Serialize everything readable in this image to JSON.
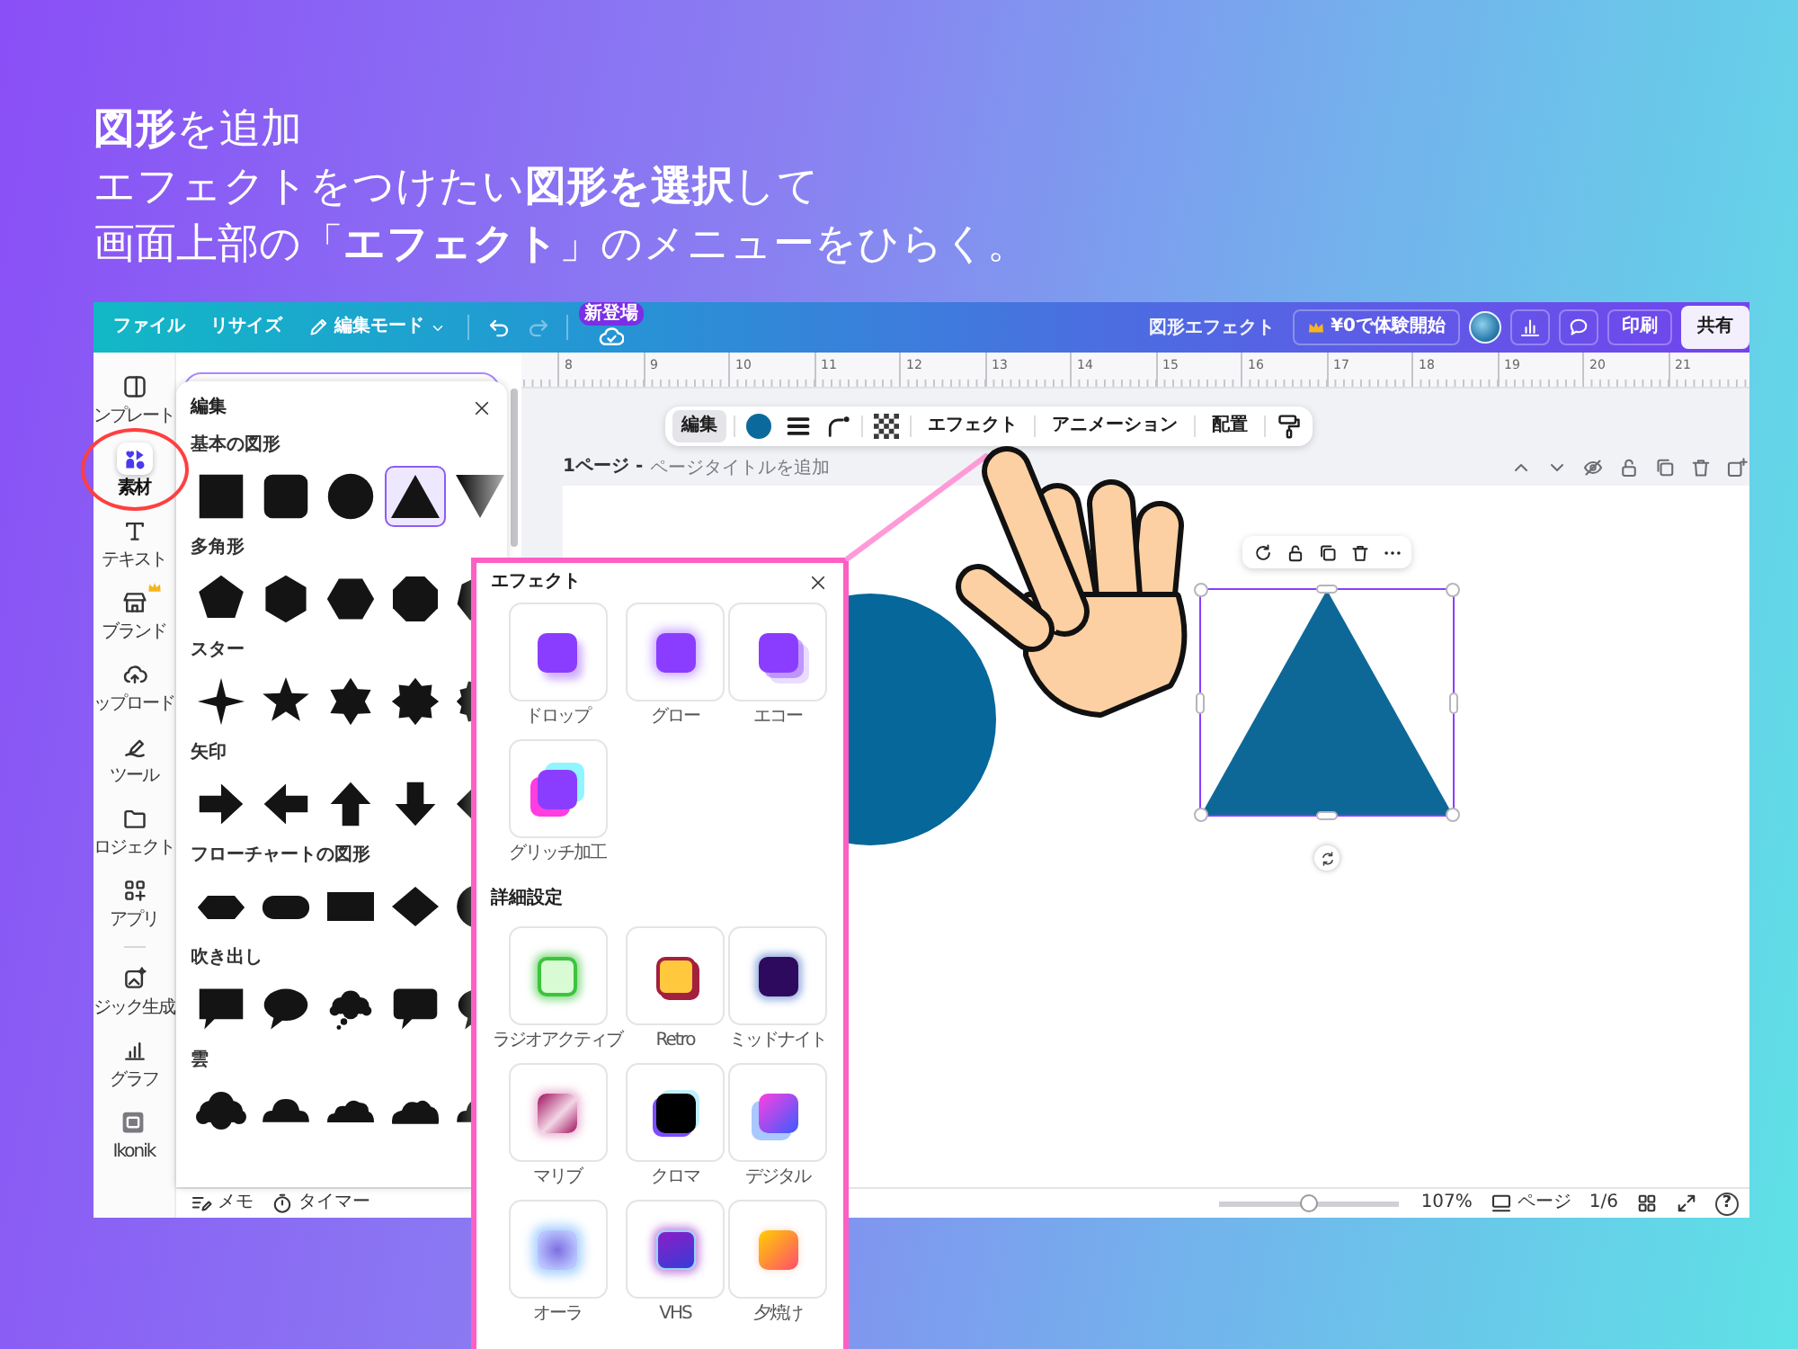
{
  "heading": {
    "lines": [
      "**図形**を追加",
      "エフェクトをつけたい**図形を選択**して",
      "画面上部の「**エフェクト**」のメニューをひらく。"
    ]
  },
  "topbar": {
    "menu": [
      "ファイル",
      "リサイズ"
    ],
    "mode_button": "編集モード",
    "history_buttons": [
      {
        "disabled": false
      },
      {
        "disabled": true
      }
    ],
    "new_badge": "新登場",
    "document_title": "図形エフェクト",
    "trial_button": "¥0で体験開始",
    "print_button": "印刷",
    "share_button": "共有"
  },
  "sidebar": {
    "items": [
      {
        "label": "ンプレート",
        "selected": false
      },
      {
        "label": "素材",
        "selected": true
      },
      {
        "label": "テキスト",
        "selected": false
      },
      {
        "label": "ブランド",
        "selected": false
      },
      {
        "label": "ップロード",
        "selected": false
      },
      {
        "label": "ツール",
        "selected": false
      },
      {
        "label": "ロジェクト",
        "selected": false
      },
      {
        "label": "アプリ",
        "selected": false
      }
    ],
    "extra_items": [
      {
        "label": "ジック生成",
        "selected": false
      },
      {
        "label": "グラフ",
        "selected": false
      },
      {
        "label": "Ikonik",
        "selected": false
      }
    ]
  },
  "shapes_panel": {
    "title": "編集",
    "sections": [
      {
        "title": "基本の図形",
        "items": [
          {
            "selected": false
          },
          {
            "selected": false
          },
          {
            "selected": false
          },
          {
            "selected": true
          },
          {
            "selected": false
          }
        ]
      },
      {
        "title": "多角形",
        "items": [
          {
            "selected": false
          },
          {
            "selected": false
          },
          {
            "selected": false
          },
          {
            "selected": false
          },
          {
            "selected": false
          }
        ]
      },
      {
        "title": "スター",
        "items": [
          {
            "selected": false
          },
          {
            "selected": false
          },
          {
            "selected": false
          },
          {
            "selected": false
          },
          {
            "selected": false
          }
        ]
      },
      {
        "title": "矢印",
        "items": [
          {
            "selected": false
          },
          {
            "selected": false
          },
          {
            "selected": false
          },
          {
            "selected": false
          },
          {
            "selected": false
          }
        ]
      },
      {
        "title": "フローチャートの図形",
        "items": [
          {
            "selected": false
          },
          {
            "selected": false
          },
          {
            "selected": false
          },
          {
            "selected": false
          },
          {
            "selected": false
          }
        ]
      },
      {
        "title": "吹き出し",
        "items": [
          {
            "selected": false
          },
          {
            "selected": false
          },
          {
            "selected": false
          },
          {
            "selected": false
          },
          {
            "selected": false
          }
        ]
      },
      {
        "title": "雲",
        "items": [
          {
            "selected": false
          },
          {
            "selected": false
          },
          {
            "selected": false
          },
          {
            "selected": false
          },
          {
            "selected": false
          }
        ]
      }
    ]
  },
  "canvas": {
    "ruler": [
      "8",
      "9",
      "10",
      "11",
      "12",
      "13",
      "14",
      "15",
      "16",
      "17",
      "18",
      "19",
      "20",
      "21"
    ],
    "context_toolbar": [
      {
        "label": "編集",
        "selected": true
      },
      {
        "label": "エフェクト",
        "selected": false
      },
      {
        "label": "アニメーション",
        "selected": false
      },
      {
        "label": "配置",
        "selected": false
      }
    ],
    "page_label": "1ページ -",
    "page_title": {
      "placeholder": "ページタイトルを追加"
    },
    "elements": [
      {
        "kind": "circle",
        "selected": false
      },
      {
        "kind": "triangle",
        "selected": true
      }
    ]
  },
  "bottom_bar": {
    "notes_button": "メモ",
    "timer_button": "タイマー",
    "zoom": {
      "level": 0.5,
      "reading": "107%"
    },
    "pages_button": "ページ",
    "page_count": "1/6",
    "help_button": "?"
  },
  "effects_panel": {
    "title": "エフェクト",
    "basic": [
      {
        "label": "ドロップ",
        "selected": false
      },
      {
        "label": "グロー",
        "selected": false
      },
      {
        "label": "エコー",
        "selected": false
      },
      {
        "label": "グリッチ加工",
        "selected": false
      }
    ],
    "advanced_title": "詳細設定",
    "advanced": [
      {
        "label": "ラジオアクティブ",
        "selected": false
      },
      {
        "label": "Retro",
        "selected": false
      },
      {
        "label": "ミッドナイト",
        "selected": false
      },
      {
        "label": "マリブ",
        "selected": false
      },
      {
        "label": "クロマ",
        "selected": false
      },
      {
        "label": "デジタル",
        "selected": false
      },
      {
        "label": "オーラ",
        "selected": false
      },
      {
        "label": "VHS",
        "selected": false
      },
      {
        "label": "夕焼け",
        "selected": false
      }
    ]
  }
}
